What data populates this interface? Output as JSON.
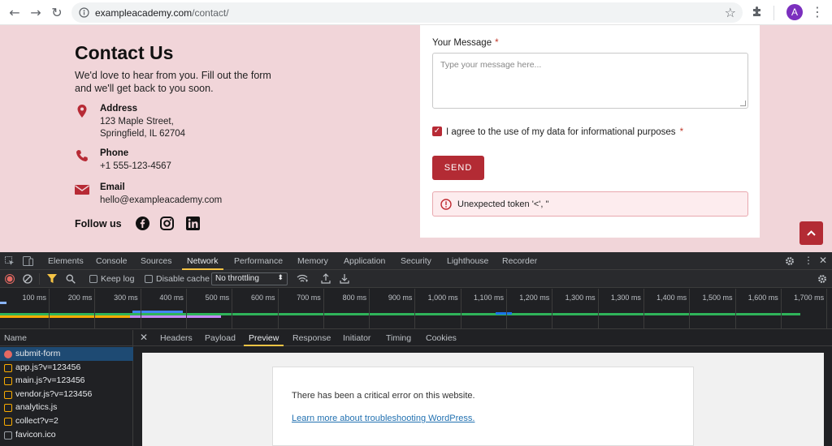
{
  "browser": {
    "url_host": "exampleacademy.com",
    "url_path": "/contact/",
    "profile_initial": "A"
  },
  "contact": {
    "title": "Contact Us",
    "intro": "We'd love to hear from you. Fill out the form and we'll get back to you soon.",
    "address_label": "Address",
    "address_line1": "123 Maple Street,",
    "address_line2": "Springfield, IL 62704",
    "phone_label": "Phone",
    "phone_value": "+1 555-123-4567",
    "email_label": "Email",
    "email_value": "hello@exampleacademy.com",
    "follow_label": "Follow us"
  },
  "form": {
    "message_label": "Your Message",
    "required_mark": "*",
    "message_placeholder": "Type your message here...",
    "agree_text": "I agree to the use of my data for informational purposes",
    "agree_checked": true,
    "send_label": "SEND",
    "error_text": "Unexpected token '<', \""
  },
  "devtools": {
    "tabs": [
      "Elements",
      "Console",
      "Sources",
      "Network",
      "Performance",
      "Memory",
      "Application",
      "Security",
      "Lighthouse",
      "Recorder"
    ],
    "active_tab": "Network",
    "keep_log": "Keep log",
    "disable_cache": "Disable cache",
    "throttling": "No throttling",
    "timeline_ticks": [
      "100 ms",
      "200 ms",
      "300 ms",
      "400 ms",
      "500 ms",
      "600 ms",
      "700 ms",
      "800 ms",
      "900 ms",
      "1,000 ms",
      "1,100 ms",
      "1,200 ms",
      "1,300 ms",
      "1,300 ms",
      "1,400 ms",
      "1,500 ms",
      "1,600 ms",
      "1,700 ms"
    ],
    "name_header": "Name",
    "requests": [
      {
        "name": "submit-form",
        "status": "error"
      },
      {
        "name": "app.js?v=123456",
        "status": "script"
      },
      {
        "name": "main.js?v=123456",
        "status": "script"
      },
      {
        "name": "vendor.js?v=123456",
        "status": "script"
      },
      {
        "name": "analytics.js",
        "status": "script"
      },
      {
        "name": "collect?v=2",
        "status": "script"
      },
      {
        "name": "favicon.ico",
        "status": "doc"
      }
    ],
    "detail_tabs": [
      "Headers",
      "Payload",
      "Preview",
      "Response",
      "Initiator",
      "Timing",
      "Cookies"
    ],
    "active_detail_tab": "Preview",
    "preview_message": "There has been a critical error on this website.",
    "preview_link": "Learn more about troubleshooting WordPress."
  },
  "colors": {
    "page_bg": "#f1d5d9",
    "accent": "#b32b34",
    "devtools_bg": "#202124",
    "active_tab_underline": "#f6c445"
  }
}
